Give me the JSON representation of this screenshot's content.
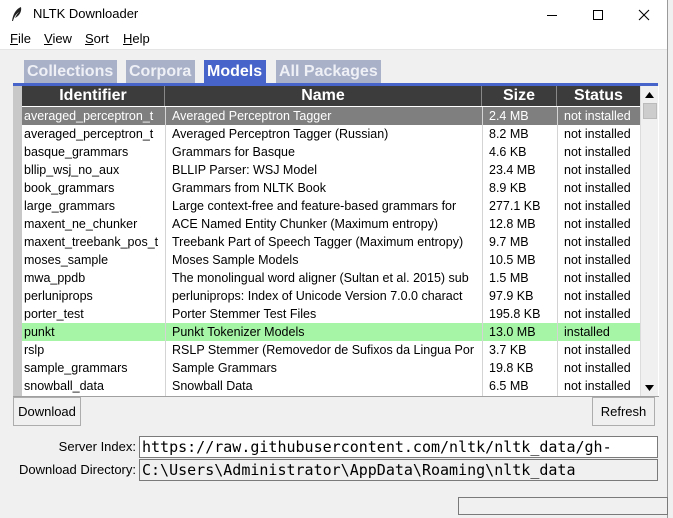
{
  "window": {
    "title": "NLTK Downloader",
    "icon": "feather-pen-icon"
  },
  "menu": [
    {
      "label": "File",
      "key": "F",
      "rest": "ile"
    },
    {
      "label": "View",
      "key": "V",
      "rest": "iew"
    },
    {
      "label": "Sort",
      "key": "S",
      "rest": "ort"
    },
    {
      "label": "Help",
      "key": "H",
      "rest": "elp"
    }
  ],
  "tabs": [
    {
      "label": "Collections",
      "active": false
    },
    {
      "label": "Corpora",
      "active": false
    },
    {
      "label": "Models",
      "active": true
    },
    {
      "label": "All Packages",
      "active": false
    }
  ],
  "table": {
    "columns": [
      "Identifier",
      "Name",
      "Size",
      "Status"
    ],
    "rows": [
      [
        "averaged_perceptron_t",
        "Averaged Perceptron Tagger",
        "2.4 MB",
        "not installed"
      ],
      [
        "averaged_perceptron_t",
        "Averaged Perceptron Tagger (Russian)",
        "8.2 MB",
        "not installed"
      ],
      [
        "basque_grammars",
        "Grammars for Basque",
        "4.6 KB",
        "not installed"
      ],
      [
        "bllip_wsj_no_aux",
        "BLLIP Parser: WSJ Model",
        "23.4 MB",
        "not installed"
      ],
      [
        "book_grammars",
        "Grammars from NLTK Book",
        "8.9 KB",
        "not installed"
      ],
      [
        "large_grammars",
        "Large context-free and feature-based grammars for",
        "277.1 KB",
        "not installed"
      ],
      [
        "maxent_ne_chunker",
        "ACE Named Entity Chunker (Maximum entropy)",
        "12.8 MB",
        "not installed"
      ],
      [
        "maxent_treebank_pos_t",
        "Treebank Part of Speech Tagger (Maximum entropy)",
        "9.7 MB",
        "not installed"
      ],
      [
        "moses_sample",
        "Moses Sample Models",
        "10.5 MB",
        "not installed"
      ],
      [
        "mwa_ppdb",
        "The monolingual word aligner (Sultan et al. 2015) sub",
        "1.5 MB",
        "not installed"
      ],
      [
        "perluniprops",
        "perluniprops: Index of Unicode Version 7.0.0 charact",
        "97.9 KB",
        "not installed"
      ],
      [
        "porter_test",
        "Porter Stemmer Test Files",
        "195.8 KB",
        "not installed"
      ],
      [
        "punkt",
        "Punkt Tokenizer Models",
        "13.0 MB",
        "installed"
      ],
      [
        "rslp",
        "RSLP Stemmer (Removedor de Sufixos da Lingua Por",
        "3.7 KB",
        "not installed"
      ],
      [
        "sample_grammars",
        "Sample Grammars",
        "19.8 KB",
        "not installed"
      ],
      [
        "snowball_data",
        "Snowball Data",
        "6.5 MB",
        "not installed"
      ]
    ],
    "selected_row": 0,
    "installed_row": 12
  },
  "buttons": {
    "download": "Download",
    "refresh": "Refresh"
  },
  "server": {
    "label": "Server Index:",
    "value": "https://raw.githubusercontent.com/nltk/nltk_data/gh-"
  },
  "directory": {
    "label": "Download Directory:",
    "value": "C:\\Users\\Administrator\\AppData\\Roaming\\nltk_data"
  },
  "colors": {
    "active_tab": "#4664c9",
    "inactive_tab": "#a9b1c9",
    "installed_row": "#a6f5a6",
    "selected_row": "#7f7f7f",
    "header": "#3c3c3c"
  }
}
